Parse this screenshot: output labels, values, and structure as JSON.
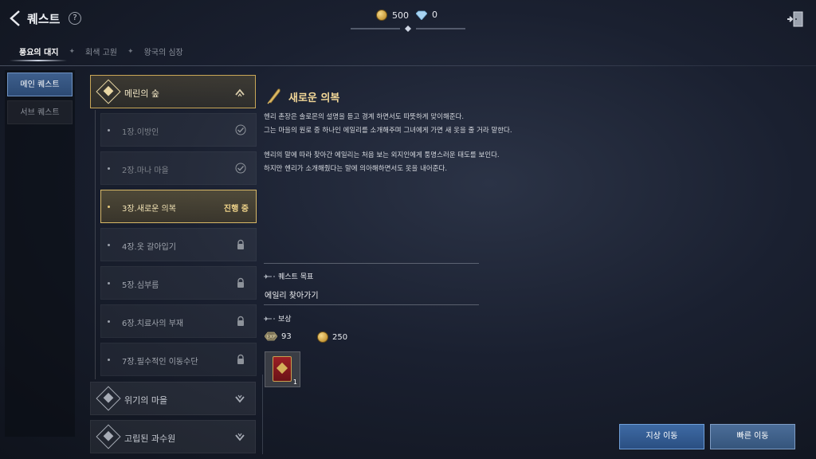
{
  "header": {
    "title": "퀘스트",
    "help_symbol": "?"
  },
  "currency": {
    "gold": "500",
    "diamond": "0"
  },
  "region_tabs": [
    {
      "label": "풍요의 대지",
      "active": true
    },
    {
      "label": "회색 고원",
      "active": false
    },
    {
      "label": "왕국의 심장",
      "active": false
    }
  ],
  "categories": {
    "main": "메인 퀘스트",
    "sub": "서브 퀘스트"
  },
  "chapter_group": {
    "label": "메린의 숲",
    "quests": [
      {
        "label": "1장.이방인",
        "status": "done"
      },
      {
        "label": "2장.마나 마을",
        "status": "done"
      },
      {
        "label": "3장.새로운 의복",
        "status": "active",
        "status_text": "진행 중"
      },
      {
        "label": "4장.옷 갈아입기",
        "status": "locked"
      },
      {
        "label": "5장.심부름",
        "status": "locked"
      },
      {
        "label": "6장.치료사의 부재",
        "status": "locked"
      },
      {
        "label": "7장.필수적인 이동수단",
        "status": "locked"
      }
    ]
  },
  "other_groups": [
    {
      "label": "위기의 마을"
    },
    {
      "label": "고립된 과수원"
    }
  ],
  "detail": {
    "title": "새로운 의복",
    "story_lines": [
      "헨리 촌장은 솔로몬의 설명을 듣고 경계 하면서도 따뜻하게 맞이해준다.",
      "그는 마을의 원로 중 하나인 에일리를 소개해주며 그녀에게 가면 새 옷을 줄 거라 말한다.",
      "헨리의 말에 따라 찾아간 에일리는 처음 보는 외지인에게 퉁명스러운 태도를 보인다.",
      "하지만 헨리가 소개해줬다는 말에 의아해하면서도 옷을 내어준다."
    ],
    "objective_heading": "퀘스트 목표",
    "objective": "에일리 찾아가기",
    "reward_heading": "보상",
    "reward_exp": "93",
    "reward_gold": "250",
    "reward_item_count": "1"
  },
  "buttons": {
    "ground_move": "지상 이동",
    "fast_move": "빠른 이동"
  },
  "colors": {
    "gold_accent": "#d8b866",
    "primary_button": "#3e6aa4"
  }
}
